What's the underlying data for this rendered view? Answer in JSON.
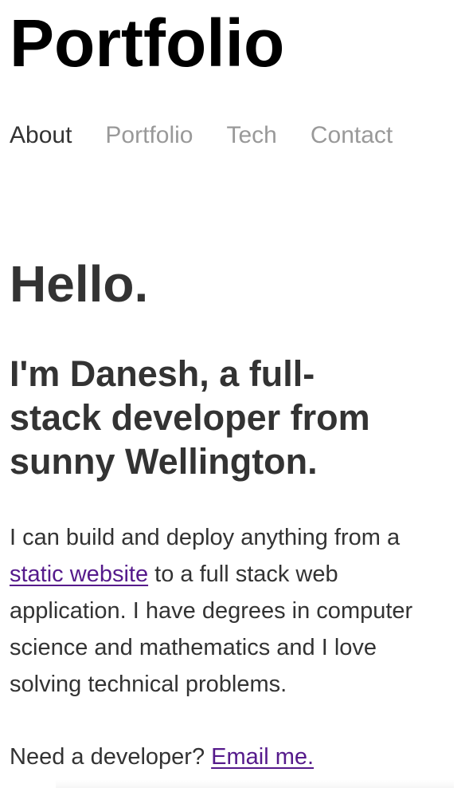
{
  "header": {
    "site_title": "Portfolio"
  },
  "nav": {
    "items": [
      {
        "label": "About",
        "active": true
      },
      {
        "label": "Portfolio",
        "active": false
      },
      {
        "label": "Tech",
        "active": false
      },
      {
        "label": "Contact",
        "active": false
      }
    ]
  },
  "main": {
    "greeting": "Hello.",
    "intro_lines": [
      "I'm Danesh, a full-",
      "stack developer from",
      "sunny Wellington."
    ],
    "paragraph": {
      "prefix": "I can build and deploy anything from a",
      "link_text": "static website",
      "after_link": " to a full stack web",
      "line3": "application. I have degrees in computer",
      "line4": "science and mathematics and I love",
      "line5": "solving technical problems."
    },
    "cta": {
      "question": "Need a developer? ",
      "link_text": "Email me."
    }
  },
  "colors": {
    "text": "#333333",
    "title": "#000000",
    "nav_inactive": "#999999",
    "link_visited": "#551a8b"
  }
}
